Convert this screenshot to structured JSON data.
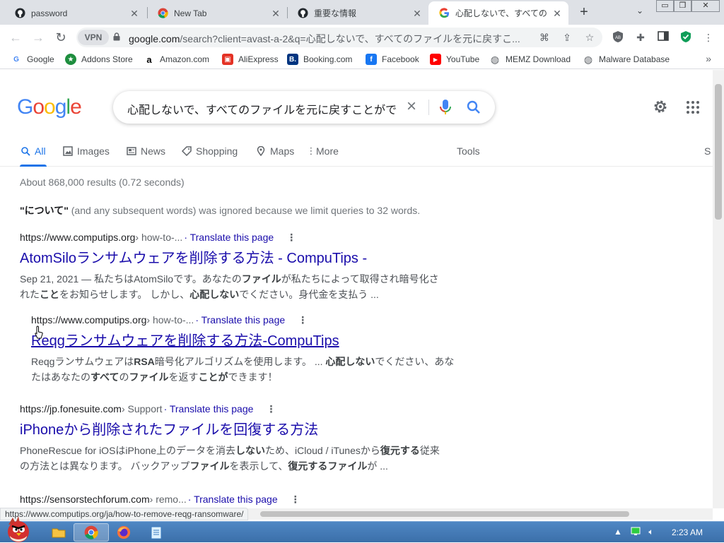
{
  "tabs": [
    {
      "title": "password",
      "icon": "github-icon"
    },
    {
      "title": "New Tab",
      "icon": "chrome-icon"
    },
    {
      "title": "重要な情報",
      "icon": "github-icon"
    },
    {
      "title": "心配しないで、すべての",
      "icon": "google-icon"
    }
  ],
  "window_controls": {
    "minimize": "▭",
    "restore": "❐",
    "close": "✕"
  },
  "toolbar": {
    "vpn_label": "VPN",
    "url_host": "google.com",
    "url_rest": "/search?client=avast-a-2&q=心配しないで、すべてのファイルを元に戻すこ..."
  },
  "bookmarks": [
    {
      "label": "Google",
      "icon": "google-icon",
      "color": "#4285f4",
      "glyph": "G"
    },
    {
      "label": "Addons Store",
      "icon": "addons-store-icon",
      "color": "#1e8e3e",
      "glyph": "★"
    },
    {
      "label": "Amazon.com",
      "icon": "amazon-icon",
      "color": "#ffffff",
      "glyph": "a"
    },
    {
      "label": "AliExpress",
      "icon": "aliexpress-icon",
      "color": "#e43225",
      "glyph": "▣"
    },
    {
      "label": "Booking.com",
      "icon": "booking-icon",
      "color": "#003580",
      "glyph": "B."
    },
    {
      "label": "Facebook",
      "icon": "facebook-icon",
      "color": "#1877f2",
      "glyph": "f"
    },
    {
      "label": "YouTube",
      "icon": "youtube-icon",
      "color": "#ff0000",
      "glyph": "▶"
    },
    {
      "label": "MEMZ Download",
      "icon": "globe-icon",
      "color": "#5f6368",
      "glyph": "◍"
    },
    {
      "label": "Malware Database",
      "icon": "globe-icon",
      "color": "#5f6368",
      "glyph": "◍"
    }
  ],
  "search": {
    "logo": "Google",
    "query": "心配しないで、すべてのファイルを元に戻すことがで"
  },
  "nav_tabs": [
    {
      "label": "All",
      "icon": "search-icon",
      "glyph": "⚲"
    },
    {
      "label": "Images",
      "icon": "image-icon",
      "glyph": "▣"
    },
    {
      "label": "News",
      "icon": "news-icon",
      "glyph": "▤"
    },
    {
      "label": "Shopping",
      "icon": "tag-icon",
      "glyph": "◇"
    },
    {
      "label": "Maps",
      "icon": "map-pin-icon",
      "glyph": "⚲"
    },
    {
      "label": "More",
      "icon": "more-vert-icon",
      "glyph": "⋮"
    },
    {
      "label": "Tools",
      "icon": "",
      "glyph": ""
    },
    {
      "label": "S",
      "icon": "",
      "glyph": ""
    }
  ],
  "stats": "About 868,000 results (0.72 seconds)",
  "notice": {
    "bold": "\"について\"",
    "rest": " (and any subsequent words) was ignored because we limit queries to 32 words."
  },
  "results": [
    {
      "host": "https://www.computips.org",
      "path": " › how-to-...",
      "translate": " · Translate this page",
      "title": "AtomSiloランサムウェアを削除する方法 - CompuTips -",
      "snippet_html": "Sep 21, 2021 — 私たちはAtomSiloです。あなたの<b>ファイル</b>が私たちによって取得され暗号化された<b>こと</b>をお知らせします。 しかし、<b>心配しない</b>でください。身代金を支払う ..."
    },
    {
      "host": "https://www.computips.org",
      "path": " › how-to-...",
      "translate": " · Translate this page",
      "title": "Reqgランサムウェアを削除する方法-CompuTips",
      "snippet_html": "Reqgランサムウェアは<b>RSA</b>暗号化アルゴリズムを使用します。 ... <b>心配しない</b>でください、あなたはあなたの<b>すべて</b>の<b>ファイル</b>を返す<b>ことが</b>できます！"
    },
    {
      "host": "https://jp.fonesuite.com",
      "path": " › Support",
      "translate": " · Translate this page",
      "title": "iPhoneから削除されたファイルを回復する方法",
      "snippet_html": "PhoneRescue for iOSはiPhone上のデータを消去<b>しない</b>ため、iCloud / iTunesから<b>復元する</b>従来の方法とは異なります。 バックアップ<b>ファイル</b>を表示して、<b>復元するファイル</b>が ..."
    },
    {
      "host": "https://sensorstechforum.com",
      "path": " › remo...",
      "translate": " · Translate this page",
      "title": "",
      "snippet_html": ""
    }
  ],
  "status_url": "https://www.computips.org/ja/how-to-remove-reqg-ransomware/",
  "taskbar": {
    "clock": "2:23 AM"
  },
  "colors": {
    "link": "#1a0dab",
    "accent": "#1a73e8",
    "taskbar": "#3b6fa9"
  }
}
